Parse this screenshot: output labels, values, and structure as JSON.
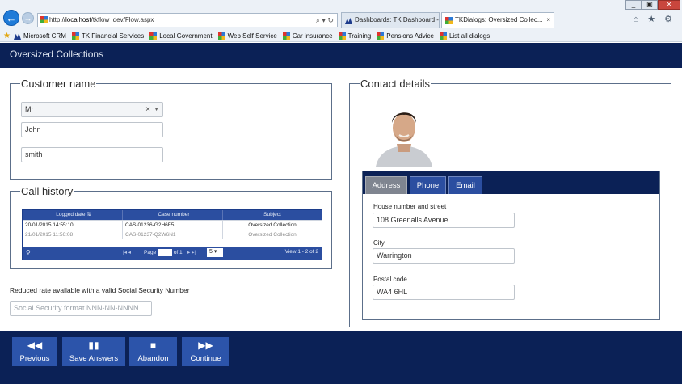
{
  "browser": {
    "url_prefix": "http://",
    "url_host": "localhost",
    "url_path": "/tkflow_dev/Flow.aspx",
    "url_tools": "⌕ ▾ ↻",
    "tabs": [
      {
        "label": "Dashboards: TK Dashboard - ..."
      },
      {
        "label": "TKDialogs: Oversized Collec..."
      }
    ],
    "tab_close": "×",
    "window_controls": [
      "_",
      "▣",
      "✕"
    ],
    "toolbar_icons": "⌂ ★ ⚙",
    "favorites": [
      "Microsoft CRM",
      "TK Financial Services",
      "Local Government",
      "Web Self Service",
      "Car insurance",
      "Training",
      "Pensions Advice",
      "List all dialogs"
    ]
  },
  "app": {
    "title": "Oversized Collections"
  },
  "customer": {
    "legend": "Customer name",
    "title_value": "Mr",
    "first_name": "John",
    "last_name": "smith",
    "clear_glyph": "×",
    "dropdown_glyph": "▼"
  },
  "call_history": {
    "legend": "Call history",
    "columns": [
      "Logged date ⇅",
      "Case number",
      "Subject"
    ],
    "rows": [
      {
        "date": "20/01/2015 14:55:10",
        "case": "CAS-01236-G2H6F5",
        "subject": "Oversized Collection"
      },
      {
        "date": "21/01/2015 11:56:08",
        "case": "CAS-01237-Q2W6N1",
        "subject": "Oversized Collection"
      }
    ],
    "pager": {
      "search_glyph": "⚲",
      "prev_controls": "|◂  ◂",
      "page_label": "Page",
      "of_label": "of 1",
      "next_controls": "▸  ▸|",
      "rows_per_page": "5 ▾",
      "view_text": "View 1 - 2 of 2"
    }
  },
  "ssn": {
    "note": "Reduced rate available with a valid Social Security Number",
    "placeholder": "Social Security format NNN-NN-NNNN"
  },
  "contact": {
    "legend": "Contact details",
    "tabs": [
      "Address",
      "Phone",
      "Email"
    ],
    "house_label": "House number and street",
    "house_value": "108 Greenalls Avenue",
    "city_label": "City",
    "city_value": "Warrington",
    "postal_label": "Postal code",
    "postal_value": "WA4 6HL"
  },
  "footer": {
    "buttons": [
      {
        "icon": "◀◀",
        "label": "Previous"
      },
      {
        "icon": "▮▮",
        "label": "Save Answers"
      },
      {
        "icon": "■",
        "label": "Abandon"
      },
      {
        "icon": "▶▶",
        "label": "Continue"
      }
    ]
  },
  "colors": {
    "header_navy": "#0b2156",
    "accent_blue": "#2c54aa",
    "active_tab_grey": "#7f8590"
  }
}
